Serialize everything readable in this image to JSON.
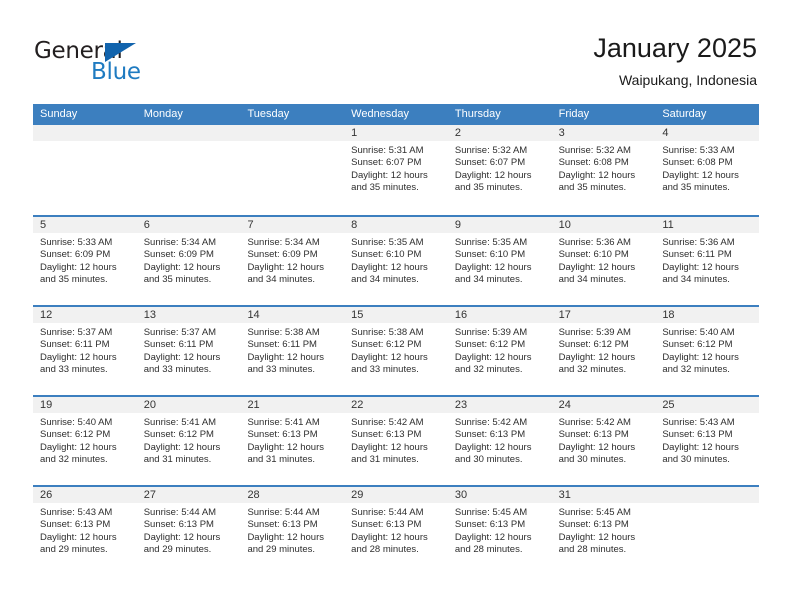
{
  "logo": {
    "word_one": "General",
    "word_two": "Blue",
    "triangle_color": "#1264ad",
    "blue_color": "#1f7bc1"
  },
  "header": {
    "title": "January 2025",
    "location": "Waipukang, Indonesia"
  },
  "theme": {
    "header_blue": "#3c7fbf",
    "band_gray": "#f1f1f1",
    "text_dark": "#2e2e2e"
  },
  "calendar": {
    "day_headers": [
      "Sunday",
      "Monday",
      "Tuesday",
      "Wednesday",
      "Thursday",
      "Friday",
      "Saturday"
    ],
    "weeks": [
      [
        {
          "day": "",
          "lines": []
        },
        {
          "day": "",
          "lines": []
        },
        {
          "day": "",
          "lines": []
        },
        {
          "day": "1",
          "lines": [
            "Sunrise: 5:31 AM",
            "Sunset: 6:07 PM",
            "Daylight: 12 hours",
            "and 35 minutes."
          ]
        },
        {
          "day": "2",
          "lines": [
            "Sunrise: 5:32 AM",
            "Sunset: 6:07 PM",
            "Daylight: 12 hours",
            "and 35 minutes."
          ]
        },
        {
          "day": "3",
          "lines": [
            "Sunrise: 5:32 AM",
            "Sunset: 6:08 PM",
            "Daylight: 12 hours",
            "and 35 minutes."
          ]
        },
        {
          "day": "4",
          "lines": [
            "Sunrise: 5:33 AM",
            "Sunset: 6:08 PM",
            "Daylight: 12 hours",
            "and 35 minutes."
          ]
        }
      ],
      [
        {
          "day": "5",
          "lines": [
            "Sunrise: 5:33 AM",
            "Sunset: 6:09 PM",
            "Daylight: 12 hours",
            "and 35 minutes."
          ]
        },
        {
          "day": "6",
          "lines": [
            "Sunrise: 5:34 AM",
            "Sunset: 6:09 PM",
            "Daylight: 12 hours",
            "and 35 minutes."
          ]
        },
        {
          "day": "7",
          "lines": [
            "Sunrise: 5:34 AM",
            "Sunset: 6:09 PM",
            "Daylight: 12 hours",
            "and 34 minutes."
          ]
        },
        {
          "day": "8",
          "lines": [
            "Sunrise: 5:35 AM",
            "Sunset: 6:10 PM",
            "Daylight: 12 hours",
            "and 34 minutes."
          ]
        },
        {
          "day": "9",
          "lines": [
            "Sunrise: 5:35 AM",
            "Sunset: 6:10 PM",
            "Daylight: 12 hours",
            "and 34 minutes."
          ]
        },
        {
          "day": "10",
          "lines": [
            "Sunrise: 5:36 AM",
            "Sunset: 6:10 PM",
            "Daylight: 12 hours",
            "and 34 minutes."
          ]
        },
        {
          "day": "11",
          "lines": [
            "Sunrise: 5:36 AM",
            "Sunset: 6:11 PM",
            "Daylight: 12 hours",
            "and 34 minutes."
          ]
        }
      ],
      [
        {
          "day": "12",
          "lines": [
            "Sunrise: 5:37 AM",
            "Sunset: 6:11 PM",
            "Daylight: 12 hours",
            "and 33 minutes."
          ]
        },
        {
          "day": "13",
          "lines": [
            "Sunrise: 5:37 AM",
            "Sunset: 6:11 PM",
            "Daylight: 12 hours",
            "and 33 minutes."
          ]
        },
        {
          "day": "14",
          "lines": [
            "Sunrise: 5:38 AM",
            "Sunset: 6:11 PM",
            "Daylight: 12 hours",
            "and 33 minutes."
          ]
        },
        {
          "day": "15",
          "lines": [
            "Sunrise: 5:38 AM",
            "Sunset: 6:12 PM",
            "Daylight: 12 hours",
            "and 33 minutes."
          ]
        },
        {
          "day": "16",
          "lines": [
            "Sunrise: 5:39 AM",
            "Sunset: 6:12 PM",
            "Daylight: 12 hours",
            "and 32 minutes."
          ]
        },
        {
          "day": "17",
          "lines": [
            "Sunrise: 5:39 AM",
            "Sunset: 6:12 PM",
            "Daylight: 12 hours",
            "and 32 minutes."
          ]
        },
        {
          "day": "18",
          "lines": [
            "Sunrise: 5:40 AM",
            "Sunset: 6:12 PM",
            "Daylight: 12 hours",
            "and 32 minutes."
          ]
        }
      ],
      [
        {
          "day": "19",
          "lines": [
            "Sunrise: 5:40 AM",
            "Sunset: 6:12 PM",
            "Daylight: 12 hours",
            "and 32 minutes."
          ]
        },
        {
          "day": "20",
          "lines": [
            "Sunrise: 5:41 AM",
            "Sunset: 6:12 PM",
            "Daylight: 12 hours",
            "and 31 minutes."
          ]
        },
        {
          "day": "21",
          "lines": [
            "Sunrise: 5:41 AM",
            "Sunset: 6:13 PM",
            "Daylight: 12 hours",
            "and 31 minutes."
          ]
        },
        {
          "day": "22",
          "lines": [
            "Sunrise: 5:42 AM",
            "Sunset: 6:13 PM",
            "Daylight: 12 hours",
            "and 31 minutes."
          ]
        },
        {
          "day": "23",
          "lines": [
            "Sunrise: 5:42 AM",
            "Sunset: 6:13 PM",
            "Daylight: 12 hours",
            "and 30 minutes."
          ]
        },
        {
          "day": "24",
          "lines": [
            "Sunrise: 5:42 AM",
            "Sunset: 6:13 PM",
            "Daylight: 12 hours",
            "and 30 minutes."
          ]
        },
        {
          "day": "25",
          "lines": [
            "Sunrise: 5:43 AM",
            "Sunset: 6:13 PM",
            "Daylight: 12 hours",
            "and 30 minutes."
          ]
        }
      ],
      [
        {
          "day": "26",
          "lines": [
            "Sunrise: 5:43 AM",
            "Sunset: 6:13 PM",
            "Daylight: 12 hours",
            "and 29 minutes."
          ]
        },
        {
          "day": "27",
          "lines": [
            "Sunrise: 5:44 AM",
            "Sunset: 6:13 PM",
            "Daylight: 12 hours",
            "and 29 minutes."
          ]
        },
        {
          "day": "28",
          "lines": [
            "Sunrise: 5:44 AM",
            "Sunset: 6:13 PM",
            "Daylight: 12 hours",
            "and 29 minutes."
          ]
        },
        {
          "day": "29",
          "lines": [
            "Sunrise: 5:44 AM",
            "Sunset: 6:13 PM",
            "Daylight: 12 hours",
            "and 28 minutes."
          ]
        },
        {
          "day": "30",
          "lines": [
            "Sunrise: 5:45 AM",
            "Sunset: 6:13 PM",
            "Daylight: 12 hours",
            "and 28 minutes."
          ]
        },
        {
          "day": "31",
          "lines": [
            "Sunrise: 5:45 AM",
            "Sunset: 6:13 PM",
            "Daylight: 12 hours",
            "and 28 minutes."
          ]
        },
        {
          "day": "",
          "lines": []
        }
      ]
    ]
  }
}
